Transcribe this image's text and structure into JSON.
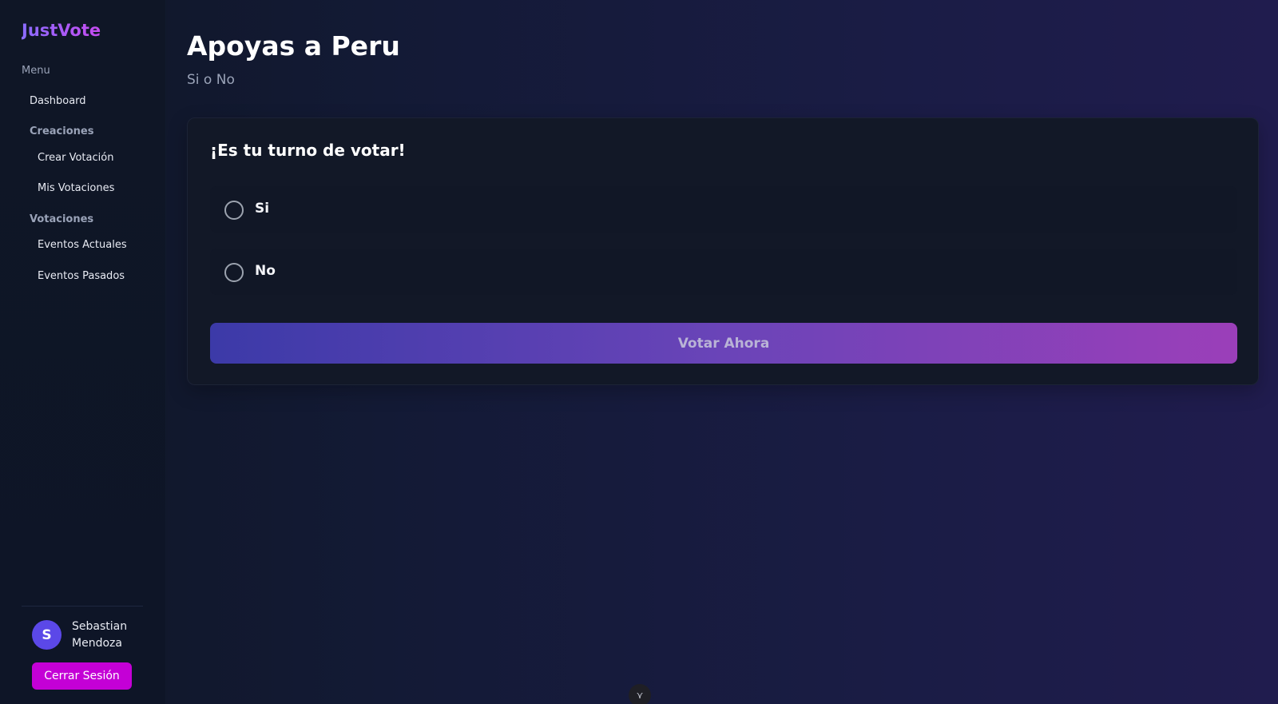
{
  "sidebar": {
    "brand": "JustVote",
    "menu_heading": "Menu",
    "dashboard": "Dashboard",
    "group_creaciones": "Creaciones",
    "crear_votacion": "Crear Votación",
    "mis_votaciones": "Mis Votaciones",
    "group_votaciones": "Votaciones",
    "eventos_actuales": "Eventos Actuales",
    "eventos_pasados": "Eventos Pasados",
    "user": {
      "initial": "S",
      "name": "Sebastian Mendoza"
    },
    "logout_label": "Cerrar Sesión"
  },
  "main": {
    "title": "Apoyas a Peru",
    "subtitle": "Si o No",
    "card": {
      "heading": "¡Es tu turno de votar!",
      "options": [
        {
          "label": "Si"
        },
        {
          "label": "No"
        }
      ],
      "submit_label": "Votar Ahora"
    }
  },
  "overlay": {
    "toggle_icon": "chevron-down-icon",
    "toggle_glyph": "⋎"
  },
  "colors": {
    "accent_brand": "#c64bf0",
    "logout_button": "#c400d6",
    "avatar": "#5b48e8"
  }
}
